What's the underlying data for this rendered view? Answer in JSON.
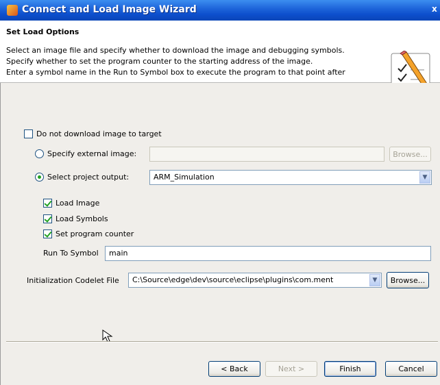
{
  "window": {
    "title": "Connect and Load Image Wizard",
    "close_glyph": "x"
  },
  "header": {
    "title": "Set Load Options",
    "lines": [
      "Select an image file and specify whether to download the image and debugging symbols.",
      "Specify whether to set the program counter to the starting address of the image.",
      "Enter a symbol name in the Run to Symbol box to execute the program to that point after"
    ],
    "icon": "pencil-checklist-icon"
  },
  "options": {
    "no_download_label": "Do not download image to target",
    "external_image_label": "Specify external image:",
    "external_image_value": "",
    "browse_label": "Browse...",
    "project_output_label": "Select project output:",
    "project_output_value": "ARM_Simulation",
    "load_image_label": "Load Image",
    "load_symbols_label": "Load Symbols",
    "set_pc_label": "Set program counter",
    "run_to_symbol_label": "Run To Symbol",
    "run_to_symbol_value": "main",
    "codelet_label": "Initialization Codelet File",
    "codelet_value": "C:\\Source\\edge\\dev\\source\\eclipse\\plugins\\com.ment",
    "codelet_browse_label": "Browse..."
  },
  "buttons": {
    "back": "< Back",
    "next": "Next >",
    "finish": "Finish",
    "cancel": "Cancel"
  },
  "colors": {
    "titlebar": "#0a46b8",
    "check": "#21a121",
    "panel": "#f0eeea"
  }
}
